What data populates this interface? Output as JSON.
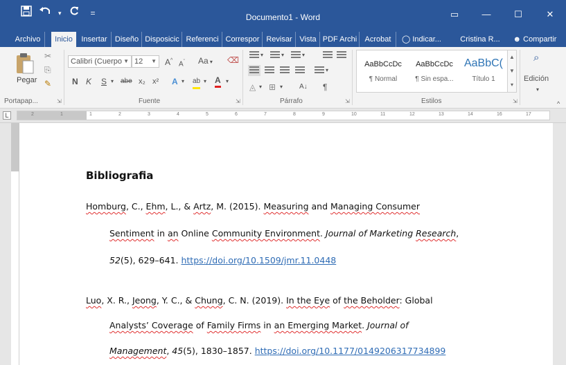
{
  "window": {
    "title": "Documento1 - Word",
    "controls": [
      "▭",
      "—",
      "☐",
      "✕"
    ]
  },
  "qat": {
    "save_icon": "save-icon",
    "undo_icon": "undo-icon",
    "redo_icon": "redo-icon",
    "customize": "="
  },
  "tabs": [
    {
      "label": "Archivo"
    },
    {
      "label": "Inicio"
    },
    {
      "label": "Insertar"
    },
    {
      "label": "Diseño"
    },
    {
      "label": "Disposicic"
    },
    {
      "label": "Referenci"
    },
    {
      "label": "Correspor"
    },
    {
      "label": "Revisar"
    },
    {
      "label": "Vista"
    },
    {
      "label": "PDF Archi"
    },
    {
      "label": "Acrobat"
    },
    {
      "label": "Indicar..."
    },
    {
      "label": "Cristina R..."
    },
    {
      "label": "Compartir"
    }
  ],
  "ribbon": {
    "clipboard": {
      "paste_label": "Pegar",
      "group_label": "Portapap..."
    },
    "font": {
      "font_name": "Calibri (Cuerpo",
      "font_size": "12",
      "grow": "A",
      "shrink": "A",
      "change_case": "Aa",
      "bold": "N",
      "italic": "K",
      "underline": "S",
      "strike": "abe",
      "subscript": "x₂",
      "superscript": "x²",
      "effects": "A",
      "highlight": "ab",
      "font_color": "A",
      "group_label": "Fuente"
    },
    "paragraph": {
      "sort": "A↓",
      "pilcrow": "¶",
      "group_label": "Párrafo"
    },
    "styles": {
      "items": [
        {
          "sample": "AaBbCcDc",
          "name": "¶ Normal"
        },
        {
          "sample": "AaBbCcDc",
          "name": "¶ Sin espa..."
        },
        {
          "sample": "AaBbC(",
          "name": "Título 1"
        }
      ],
      "group_label": "Estilos"
    },
    "editing": {
      "label": "Edición"
    }
  },
  "ruler": {
    "numbers": [
      "2",
      "1",
      "1",
      "2",
      "3",
      "4",
      "5",
      "6",
      "7",
      "8",
      "9",
      "10",
      "11",
      "12",
      "13",
      "14",
      "16",
      "17"
    ]
  },
  "document": {
    "heading": "Bibliografia",
    "entries": [
      {
        "l1_a": "Homburg",
        "l1_b": ", C., ",
        "l1_c": "Ehm",
        "l1_d": ", L., & ",
        "l1_e": "Artz",
        "l1_f": ", M. (2015). ",
        "l1_g": "Measuring",
        "l1_h": " and ",
        "l1_i": "Managing Consumer",
        "l2_a": "Sentiment",
        "l2_b": " in ",
        "l2_c": "an",
        "l2_d": " Online ",
        "l2_e": "Community Environment",
        "l2_f": ". ",
        "l2_g": "Journal of Marketing ",
        "l2_h": "Research",
        "l3_a": "52",
        "l3_b": "(5), 629–641. ",
        "l3_link": "https://doi.org/10.1509/jmr.11.0448"
      },
      {
        "l1_a": "Luo",
        "l1_b": ", X. R., ",
        "l1_c": "Jeong",
        "l1_d": ", Y. C., & ",
        "l1_e": "Chung",
        "l1_f": ", C. N. (2019). ",
        "l1_g": "In the Eye",
        "l1_h": " of ",
        "l1_i": "the Beholder",
        "l1_j": ": Global",
        "l2_a": "Analysts’ Coverage",
        "l2_b": " of ",
        "l2_c": "Family Firms",
        "l2_d": " in ",
        "l2_e": "an Emerging Market",
        "l2_f": ". ",
        "l2_g": "Journal of",
        "l3_a": "Management",
        "l3_b": ", ",
        "l3_c": "45",
        "l3_d": "(5), 1830–1857. ",
        "l3_link": "https://doi.org/10.1177/0149206317734899"
      }
    ]
  },
  "colors": {
    "accent": "#2b579a",
    "link": "#2f6cb5",
    "spell": "#e03030"
  }
}
